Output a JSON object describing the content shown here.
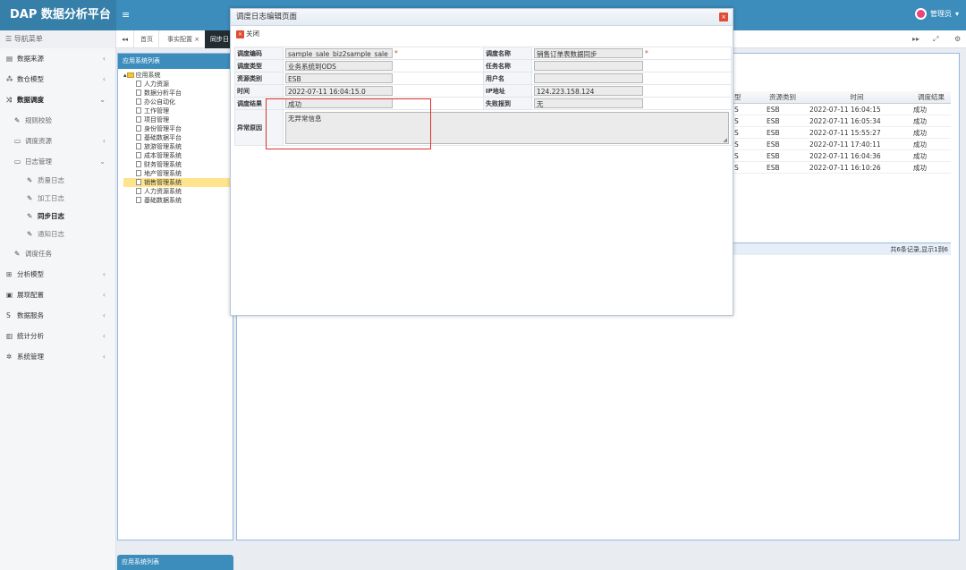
{
  "header": {
    "brand": "DAP 数据分析平台",
    "menu_icon": "≡",
    "user_name": "管理员"
  },
  "sidebar": {
    "title": "导航菜单",
    "items": [
      {
        "label": "数据来源",
        "icon": "server-icon",
        "glyph": "▤"
      },
      {
        "label": "数仓模型",
        "icon": "cubes-icon",
        "glyph": "⁂"
      },
      {
        "label": "数据调度",
        "icon": "shuffle-icon",
        "glyph": "⤨"
      },
      {
        "label": "规则校验",
        "icon": "wrench-icon",
        "glyph": "✎"
      },
      {
        "label": "调度资源",
        "icon": "folder-icon",
        "glyph": "▭"
      },
      {
        "label": "日志管理",
        "icon": "folder-icon",
        "glyph": "▭"
      },
      {
        "label": "质量日志",
        "icon": "wrench-icon",
        "glyph": "✎"
      },
      {
        "label": "加工日志",
        "icon": "wrench-icon",
        "glyph": "✎"
      },
      {
        "label": "同步日志",
        "icon": "wrench-icon",
        "glyph": "✎"
      },
      {
        "label": "通知日志",
        "icon": "wrench-icon",
        "glyph": "✎"
      },
      {
        "label": "调度任务",
        "icon": "wrench-icon",
        "glyph": "✎"
      },
      {
        "label": "分析模型",
        "icon": "sitemap-icon",
        "glyph": "⊞"
      },
      {
        "label": "展现配置",
        "icon": "window-icon",
        "glyph": "▣"
      },
      {
        "label": "数据服务",
        "icon": "dollar-icon",
        "glyph": "S"
      },
      {
        "label": "统计分析",
        "icon": "bar-chart-icon",
        "glyph": "▥"
      },
      {
        "label": "系统管理",
        "icon": "cog-icon",
        "glyph": "✲"
      }
    ]
  },
  "tabs": [
    "首页",
    "事实配置 ×",
    "同步日"
  ],
  "tabbar_icons": {
    "back": "◂◂",
    "forward": "▸▸",
    "expand": "⤢",
    "settings": "⚙"
  },
  "tree_panel": {
    "title": "应用系统列表",
    "root": "应用系统",
    "children": [
      "人力资源",
      "数据分析平台",
      "办公自动化",
      "工作管理",
      "项目管理",
      "身份管理平台",
      "基础数据平台",
      "旅游管理系统",
      "成本管理系统",
      "财务管理系统",
      "地产管理系统",
      "销售管理系统",
      "人力资源系统",
      "基础数据系统"
    ],
    "selected_index": 11
  },
  "bottom_tab": "应用系统列表",
  "grid": {
    "headers": [
      "型",
      "资源类别",
      "时间",
      "调度结果"
    ],
    "rows": [
      [
        "S",
        "ESB",
        "2022-07-11 16:04:15",
        "成功"
      ],
      [
        "S",
        "ESB",
        "2022-07-11 16:05:34",
        "成功"
      ],
      [
        "S",
        "ESB",
        "2022-07-11 15:55:27",
        "成功"
      ],
      [
        "S",
        "ESB",
        "2022-07-11 17:40:11",
        "成功"
      ],
      [
        "S",
        "ESB",
        "2022-07-11 16:04:36",
        "成功"
      ],
      [
        "S",
        "ESB",
        "2022-07-11 16:10:26",
        "成功"
      ]
    ],
    "pager": "共6条记录,显示1到6"
  },
  "dialog": {
    "title": "调度日志编辑页面",
    "close_glyph": "×",
    "toolbar_close": "关闭",
    "fields": {
      "code_label": "调度编码",
      "code_value": "sample_sale_biz2sample_sale_",
      "name_label": "调度名称",
      "name_value": "销售订单表数据同步",
      "type_label": "调度类型",
      "type_value": "业务系统到ODS",
      "task_label": "任务名称",
      "task_value": "",
      "resource_label": "资源类别",
      "resource_value": "ESB",
      "user_label": "用户名",
      "user_value": "",
      "time_label": "时间",
      "time_value": "2022-07-11 16:04:15.0",
      "ip_label": "IP地址",
      "ip_value": "124.223.158.124",
      "result_label": "调度结果",
      "result_value": "成功",
      "fail_label": "失败报到",
      "fail_value": "无",
      "error_label": "异常原因",
      "error_value": "无异常信息"
    },
    "required_mark": "*"
  },
  "colors": {
    "topbar": "#3c8dbc",
    "brand_bg": "#367fa9",
    "highlight": "#e0302b",
    "dialog_close": "#e04b32"
  }
}
